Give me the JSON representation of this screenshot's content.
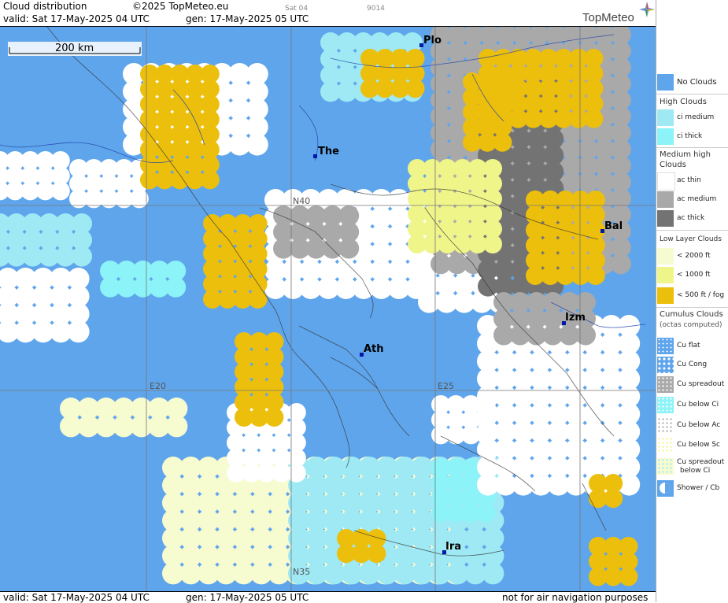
{
  "header": {
    "title": "Cloud distribution",
    "copyright": "©2025 TopMeteo.eu",
    "valid": "valid:  Sat  17-May-2025  04 UTC",
    "gen": "gen: 17-May-2025 05 UTC",
    "satellite": "Sat 04",
    "code": "9014",
    "logo": "TopMeteo"
  },
  "scale_bar": {
    "label": "200 km"
  },
  "map": {
    "cities": [
      {
        "label": "Plo"
      },
      {
        "label": "The"
      },
      {
        "label": "Bal"
      },
      {
        "label": "Izm"
      },
      {
        "label": "Ath"
      },
      {
        "label": "Ira"
      }
    ],
    "grid_labels": {
      "n40": "N40",
      "n35": "N35",
      "e20": "E20",
      "e25": "E25"
    }
  },
  "footer": {
    "valid": "valid:  Sat  17-May-2025  04 UTC",
    "gen": "gen: 17-May-2025 05 UTC",
    "disclaimer": "not for air navigation purposes"
  },
  "colors": {
    "no_clouds": "#5fa5ec",
    "ci_medium": "#9ee9f4",
    "ci_thick": "#8cf3f8",
    "ac_thin": "#ffffff",
    "ac_medium": "#a9a9a9",
    "ac_thick": "#737373",
    "low_2000": "#f7fbd0",
    "low_1000": "#f0f58a",
    "low_500": "#ecbf0c"
  },
  "legend": {
    "no_clouds": "No Clouds",
    "high_clouds": "High Clouds",
    "ci_medium": "ci medium",
    "ci_thick": "ci thick",
    "medium_high": "Medium high",
    "clouds": "Clouds",
    "ac_thin": "ac thin",
    "ac_medium": "ac medium",
    "ac_thick": "ac thick",
    "low_layer": "Low Layer Clouds",
    "low_2000": "< 2000 ft",
    "low_1000": "< 1000 ft",
    "low_500": "< 500 ft / fog",
    "cumulus": "Cumulus Clouds",
    "octas": "(octas computed)",
    "cu_flat": "Cu flat",
    "cu_cong": "Cu Cong",
    "cu_spreadout": "Cu spreadout",
    "cu_below_ci": "Cu below Ci",
    "cu_below_ac": "Cu below Ac",
    "cu_below_sc": "Cu below Sc",
    "cu_spreadout_ci_1": "Cu spreadout",
    "cu_spreadout_ci_2": "below Ci",
    "shower": "Shower / Cb"
  }
}
